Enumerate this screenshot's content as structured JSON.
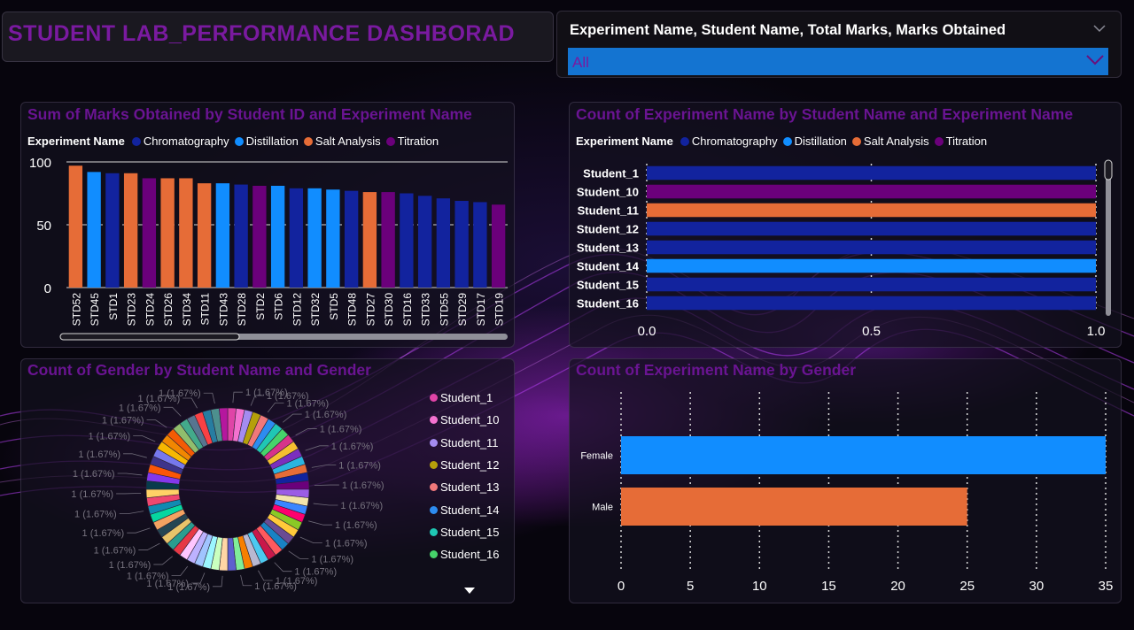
{
  "dashboard": {
    "title": "STUDENT LAB_PERFORMANCE DASHBORAD"
  },
  "slicer": {
    "label": "Experiment Name, Student Name, Total Marks, Marks Obtained",
    "value": "All"
  },
  "colors": {
    "Chromatography": "#12239e",
    "Distillation": "#118dff",
    "Salt Analysis": "#e66c37",
    "Titration": "#6b007b"
  },
  "legend": {
    "title": "Experiment Name",
    "items": [
      "Chromatography",
      "Distillation",
      "Salt Analysis",
      "Titration"
    ]
  },
  "chart_data": [
    {
      "type": "bar",
      "title": "Sum of Marks Obtained by Student ID and Experiment Name",
      "xlabel": "",
      "ylabel": "",
      "ylim": [
        0,
        100
      ],
      "yticks": [
        "100",
        "50",
        "0"
      ],
      "grid": true,
      "legend_position": "top-left",
      "categories": [
        "STD52",
        "STD45",
        "STD1",
        "STD23",
        "STD24",
        "STD26",
        "STD34",
        "STD11",
        "STD43",
        "STD28",
        "STD2",
        "STD6",
        "STD12",
        "STD32",
        "STD5",
        "STD48",
        "STD27",
        "STD30",
        "STD16",
        "STD33",
        "STD55",
        "STD29",
        "STD17",
        "STD19"
      ],
      "values": [
        97,
        92,
        91,
        91,
        87,
        87,
        87,
        83,
        83,
        82,
        81,
        81,
        79,
        79,
        78,
        77,
        76,
        76,
        75,
        73,
        71,
        69,
        68,
        66
      ],
      "series_by_category": [
        "Salt Analysis",
        "Distillation",
        "Chromatography",
        "Salt Analysis",
        "Titration",
        "Salt Analysis",
        "Salt Analysis",
        "Salt Analysis",
        "Distillation",
        "Chromatography",
        "Titration",
        "Distillation",
        "Chromatography",
        "Distillation",
        "Distillation",
        "Chromatography",
        "Salt Analysis",
        "Titration",
        "Chromatography",
        "Chromatography",
        "Chromatography",
        "Chromatography",
        "Chromatography",
        "Titration"
      ]
    },
    {
      "type": "bar",
      "orientation": "horizontal",
      "title": "Count of Experiment Name by Student Name and Experiment Name",
      "xlim": [
        0,
        1
      ],
      "xticks": [
        "0.0",
        "0.5",
        "1.0"
      ],
      "legend_position": "top-left",
      "categories": [
        "Student_1",
        "Student_10",
        "Student_11",
        "Student_12",
        "Student_13",
        "Student_14",
        "Student_15",
        "Student_16"
      ],
      "values": [
        1,
        1,
        1,
        1,
        1,
        1,
        1,
        1
      ],
      "series_by_category": [
        "Chromatography",
        "Titration",
        "Salt Analysis",
        "Chromatography",
        "Chromatography",
        "Distillation",
        "Chromatography",
        "Chromatography"
      ]
    },
    {
      "type": "pie",
      "variant": "donut",
      "title": "Count of Gender by Student Name and Gender",
      "slice_count": 60,
      "slice_value": 1,
      "slice_label": "1 (1.67%)",
      "legend_position": "right",
      "legend_items": [
        {
          "name": "Student_1",
          "color": "#e044a7"
        },
        {
          "name": "Student_10",
          "color": "#f472d0"
        },
        {
          "name": "Student_11",
          "color": "#a48cf0"
        },
        {
          "name": "Student_12",
          "color": "#b5a00a"
        },
        {
          "name": "Student_13",
          "color": "#f0787a"
        },
        {
          "name": "Student_14",
          "color": "#2d8cf0"
        },
        {
          "name": "Student_15",
          "color": "#1fc7b4"
        },
        {
          "name": "Student_16",
          "color": "#46d36a"
        }
      ],
      "slice_colors": [
        "#e044a7",
        "#f472d0",
        "#a48cf0",
        "#b5a00a",
        "#f0787a",
        "#2d8cf0",
        "#1fc7b4",
        "#46d36a",
        "#d6338a",
        "#f5c030",
        "#7b2fbe",
        "#2bb5e0",
        "#e66c37",
        "#12239e",
        "#6b007b",
        "#9b5de5",
        "#f3e5ab",
        "#3a86ff",
        "#ff006e",
        "#8ac926",
        "#ffca3a",
        "#6a4c93",
        "#1982c4",
        "#ff595e",
        "#c9184a",
        "#4cc9f0",
        "#b8b8d1",
        "#f77f00",
        "#80ed99",
        "#5e60ce",
        "#ffd6a5",
        "#caffbf",
        "#9bf6ff",
        "#a0c4ff",
        "#bdb2ff",
        "#ffc6ff",
        "#e63946",
        "#2a9d8f",
        "#e9c46a",
        "#264653",
        "#f4a261",
        "#06d6a0",
        "#118ab2",
        "#ef476f",
        "#ffd166",
        "#073b4c",
        "#8338ec",
        "#fb5607",
        "#3d348b",
        "#7678ed",
        "#f7b801",
        "#f18701",
        "#f35b04",
        "#90be6d",
        "#43aa8b",
        "#577590",
        "#f94144",
        "#277da1",
        "#4d908e",
        "#b5179e"
      ]
    },
    {
      "type": "bar",
      "orientation": "horizontal",
      "title": "Count of Experiment Name by Gender",
      "categories": [
        "Female",
        "Male"
      ],
      "values": [
        35,
        25
      ],
      "colors": [
        "#118dff",
        "#e66c37"
      ],
      "xlim": [
        0,
        35
      ],
      "xticks": [
        "0",
        "5",
        "10",
        "15",
        "20",
        "25",
        "30",
        "35"
      ],
      "grid": true
    }
  ]
}
